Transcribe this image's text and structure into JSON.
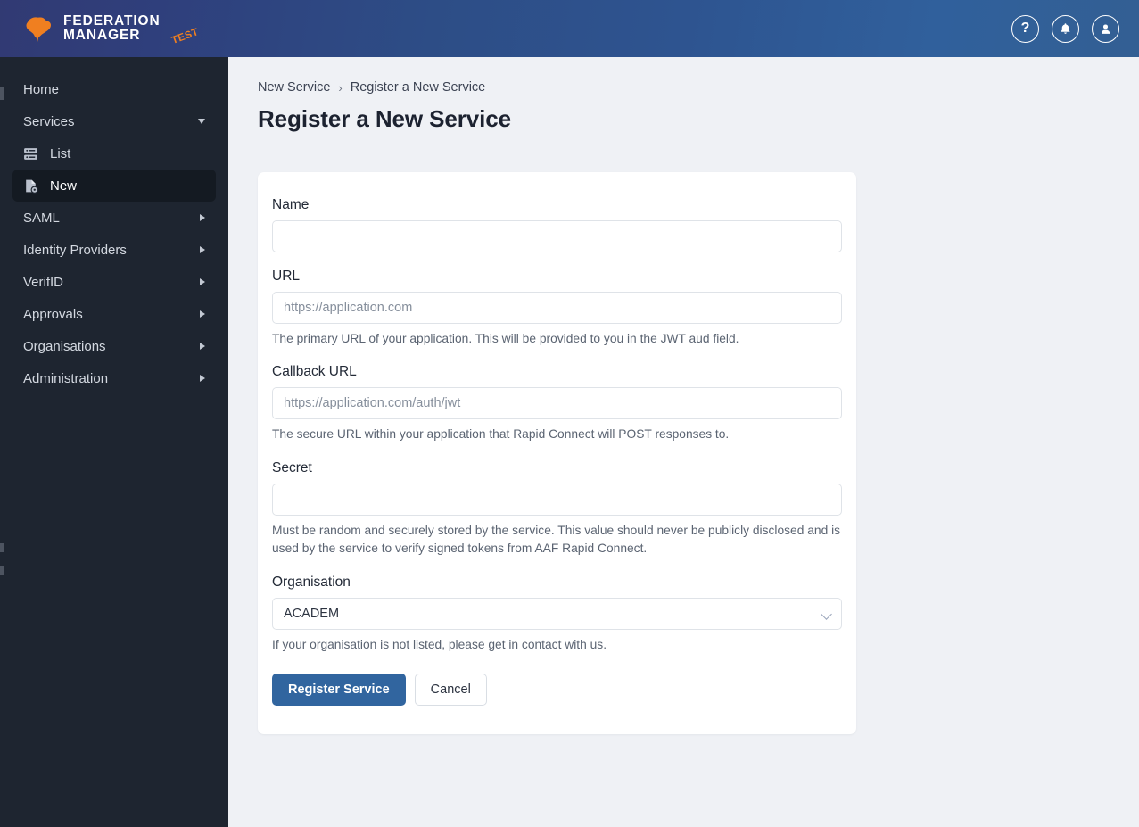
{
  "brand": {
    "line1": "FEDERATION",
    "line2": "MANAGER",
    "badge": "TEST",
    "badge_color": "#f07f20",
    "header_gradient_start": "#313a73",
    "header_gradient_end": "#335f93"
  },
  "topbar": {
    "icons": [
      {
        "name": "help-icon",
        "glyph": "?"
      },
      {
        "name": "notifications-bell-icon",
        "glyph": "bell"
      },
      {
        "name": "user-account-icon",
        "glyph": "person"
      }
    ]
  },
  "sidebar": {
    "items": [
      {
        "label": "Home",
        "icon": "",
        "chevron": "none",
        "active": false,
        "sub": false
      },
      {
        "label": "Services",
        "icon": "",
        "chevron": "down",
        "active": false,
        "sub": false
      },
      {
        "label": "List",
        "icon": "server-icon",
        "chevron": "none",
        "active": false,
        "sub": true
      },
      {
        "label": "New",
        "icon": "new-document-icon",
        "chevron": "none",
        "active": true,
        "sub": true
      },
      {
        "label": "SAML",
        "icon": "",
        "chevron": "right",
        "active": false,
        "sub": false
      },
      {
        "label": "Identity Providers",
        "icon": "",
        "chevron": "right",
        "active": false,
        "sub": false
      },
      {
        "label": "VerifID",
        "icon": "",
        "chevron": "right",
        "active": false,
        "sub": false
      },
      {
        "label": "Approvals",
        "icon": "",
        "chevron": "right",
        "active": false,
        "sub": false
      },
      {
        "label": "Organisations",
        "icon": "",
        "chevron": "right",
        "active": false,
        "sub": false
      },
      {
        "label": "Administration",
        "icon": "",
        "chevron": "right",
        "active": false,
        "sub": false
      }
    ]
  },
  "breadcrumb": {
    "parent": "New Service",
    "separator": "›",
    "current": "Register a New Service"
  },
  "page": {
    "title": "Register a New Service"
  },
  "form": {
    "name": {
      "label": "Name",
      "value": "",
      "placeholder": "",
      "help": ""
    },
    "url": {
      "label": "URL",
      "value": "",
      "placeholder": "https://application.com",
      "help": "The primary URL of your application. This will be provided to you in the JWT aud field."
    },
    "callback_url": {
      "label": "Callback URL",
      "value": "",
      "placeholder": "https://application.com/auth/jwt",
      "help": "The secure URL within your application that Rapid Connect will POST responses to."
    },
    "secret": {
      "label": "Secret",
      "value": "",
      "placeholder": "",
      "help": "Must be random and securely stored by the service. This value should never be publicly disclosed and is used by the service to verify signed tokens from AAF Rapid Connect."
    },
    "organisation": {
      "label": "Organisation",
      "value": "ACADEM",
      "help": "If your organisation is not listed, please get in contact with us."
    },
    "submit_label": "Register Service",
    "cancel_label": "Cancel",
    "primary_color": "#31659f"
  }
}
